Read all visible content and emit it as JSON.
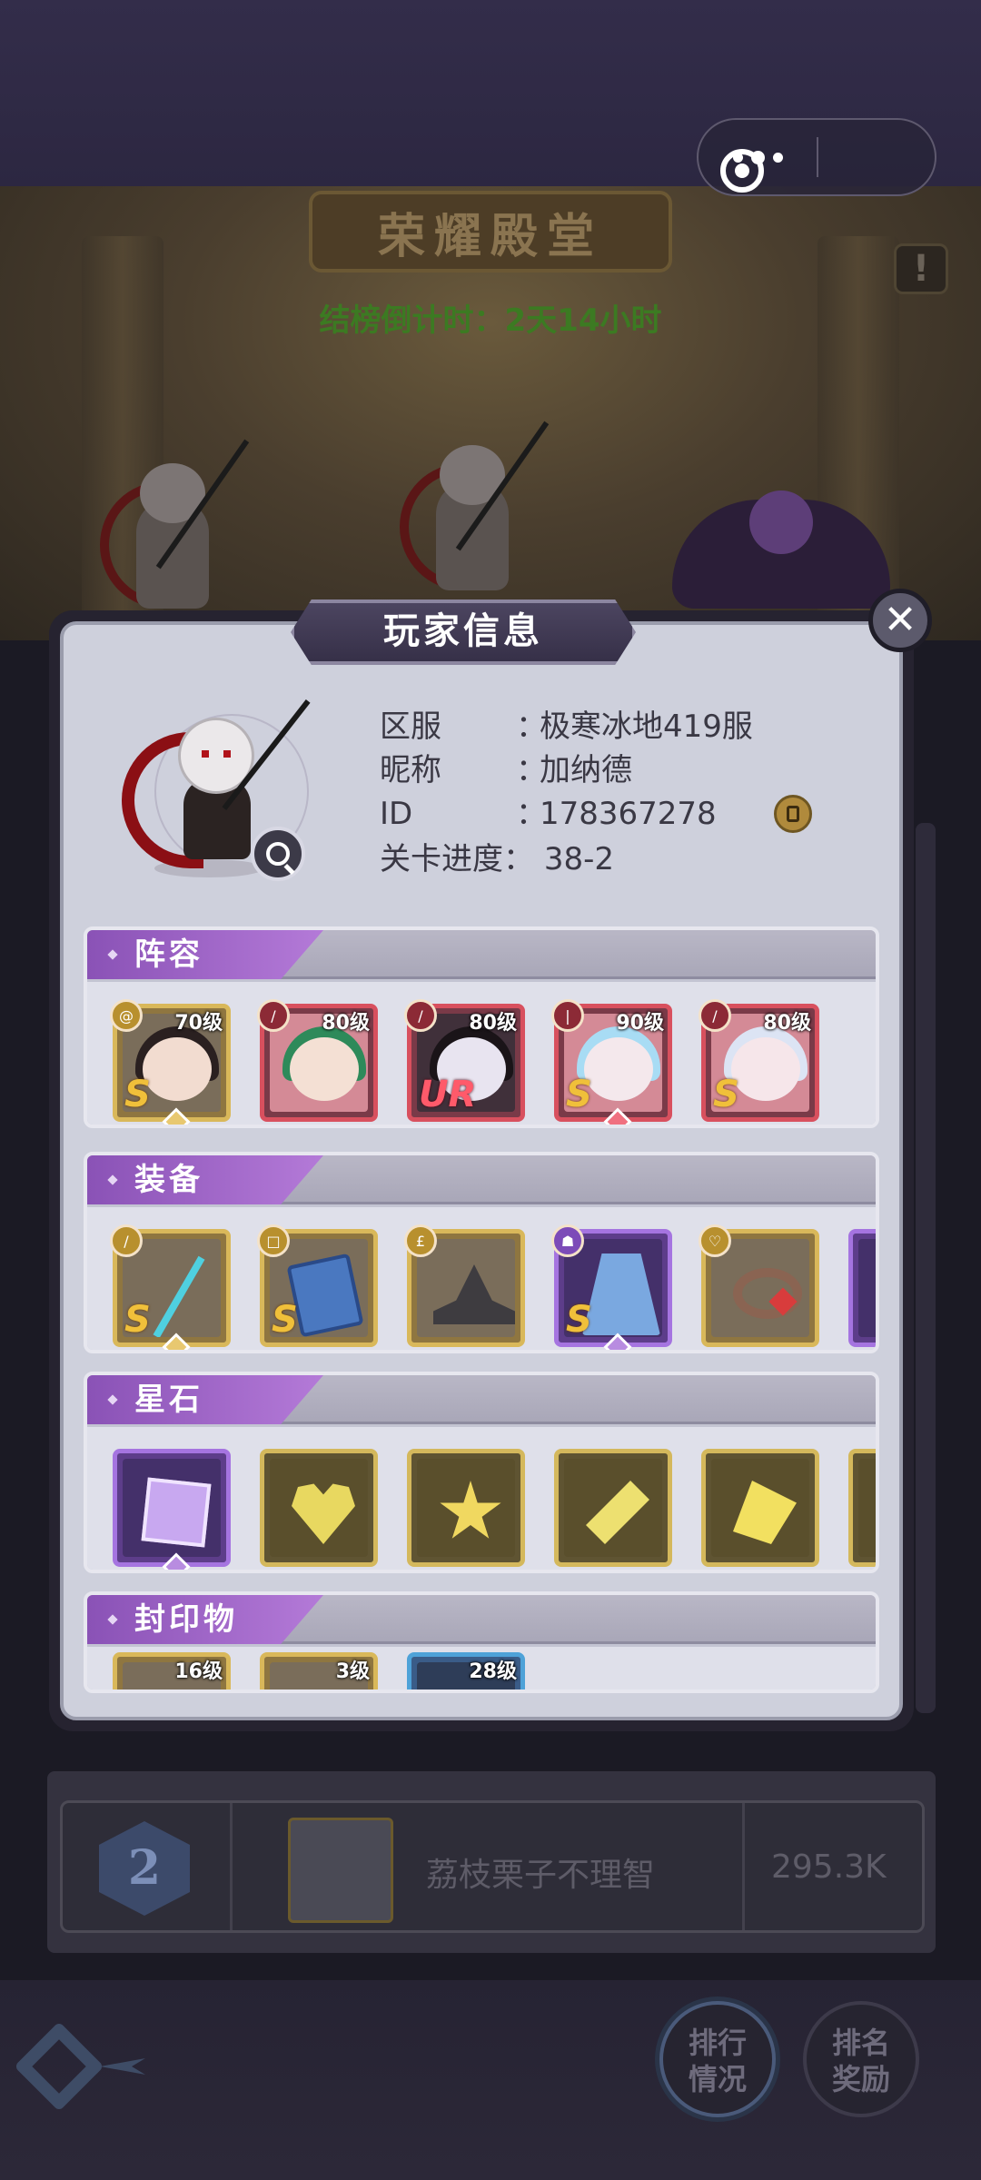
{
  "scene": {
    "hall_title": "荣耀殿堂",
    "countdown": "结榜倒计时：2天14小时",
    "info_symbol": "!"
  },
  "dialog": {
    "title": "玩家信息",
    "close_symbol": "✕",
    "player": {
      "server_label": "区服",
      "server_value": "极寒冰地419服",
      "nickname_label": "昵称",
      "nickname_value": "加纳德",
      "id_label": "ID",
      "id_value": "178367278",
      "stage_label": "关卡进度：",
      "stage_value": "38-2",
      "colon": "："
    },
    "sections": {
      "lineup": {
        "label": "阵容",
        "heroes": [
          {
            "level": "70级",
            "rank": "S",
            "class_icon": "swirl-icon"
          },
          {
            "level": "80级",
            "rank": "",
            "class_icon": "sword-icon"
          },
          {
            "level": "80级",
            "rank": "UR",
            "class_icon": "sword-icon"
          },
          {
            "level": "90级",
            "rank": "S",
            "class_icon": "staff-icon"
          },
          {
            "level": "80级",
            "rank": "S",
            "class_icon": "sword-icon"
          }
        ]
      },
      "equipment": {
        "label": "装备",
        "items": [
          {
            "rank": "S",
            "name": "trident-icon"
          },
          {
            "rank": "S",
            "name": "book-icon"
          },
          {
            "rank": "",
            "name": "hat-icon"
          },
          {
            "rank": "S",
            "name": "cape-icon"
          },
          {
            "rank": "",
            "name": "ring-icon"
          }
        ]
      },
      "stars": {
        "label": "星石",
        "items": [
          "square-gem-icon",
          "heart-gem-icon",
          "star-gem-icon",
          "diamond-gem-icon",
          "triangle-gem-icon"
        ]
      },
      "seals": {
        "label": "封印物",
        "items": [
          {
            "level": "16级"
          },
          {
            "level": "3级"
          },
          {
            "level": "28级"
          }
        ]
      }
    }
  },
  "ranking": {
    "rank": "2",
    "name": "荔枝栗子不理智",
    "power": "295.3K"
  },
  "buttons": {
    "rank_status": "排行\n情况",
    "rank_reward": "排名\n奖励"
  },
  "colors": {
    "section_tag": "#9a62c6",
    "dialog_bg": "#ced0dc",
    "gold_frame": "#d9b85a",
    "red_frame": "#d8505e",
    "purple_frame": "#a574e0"
  }
}
